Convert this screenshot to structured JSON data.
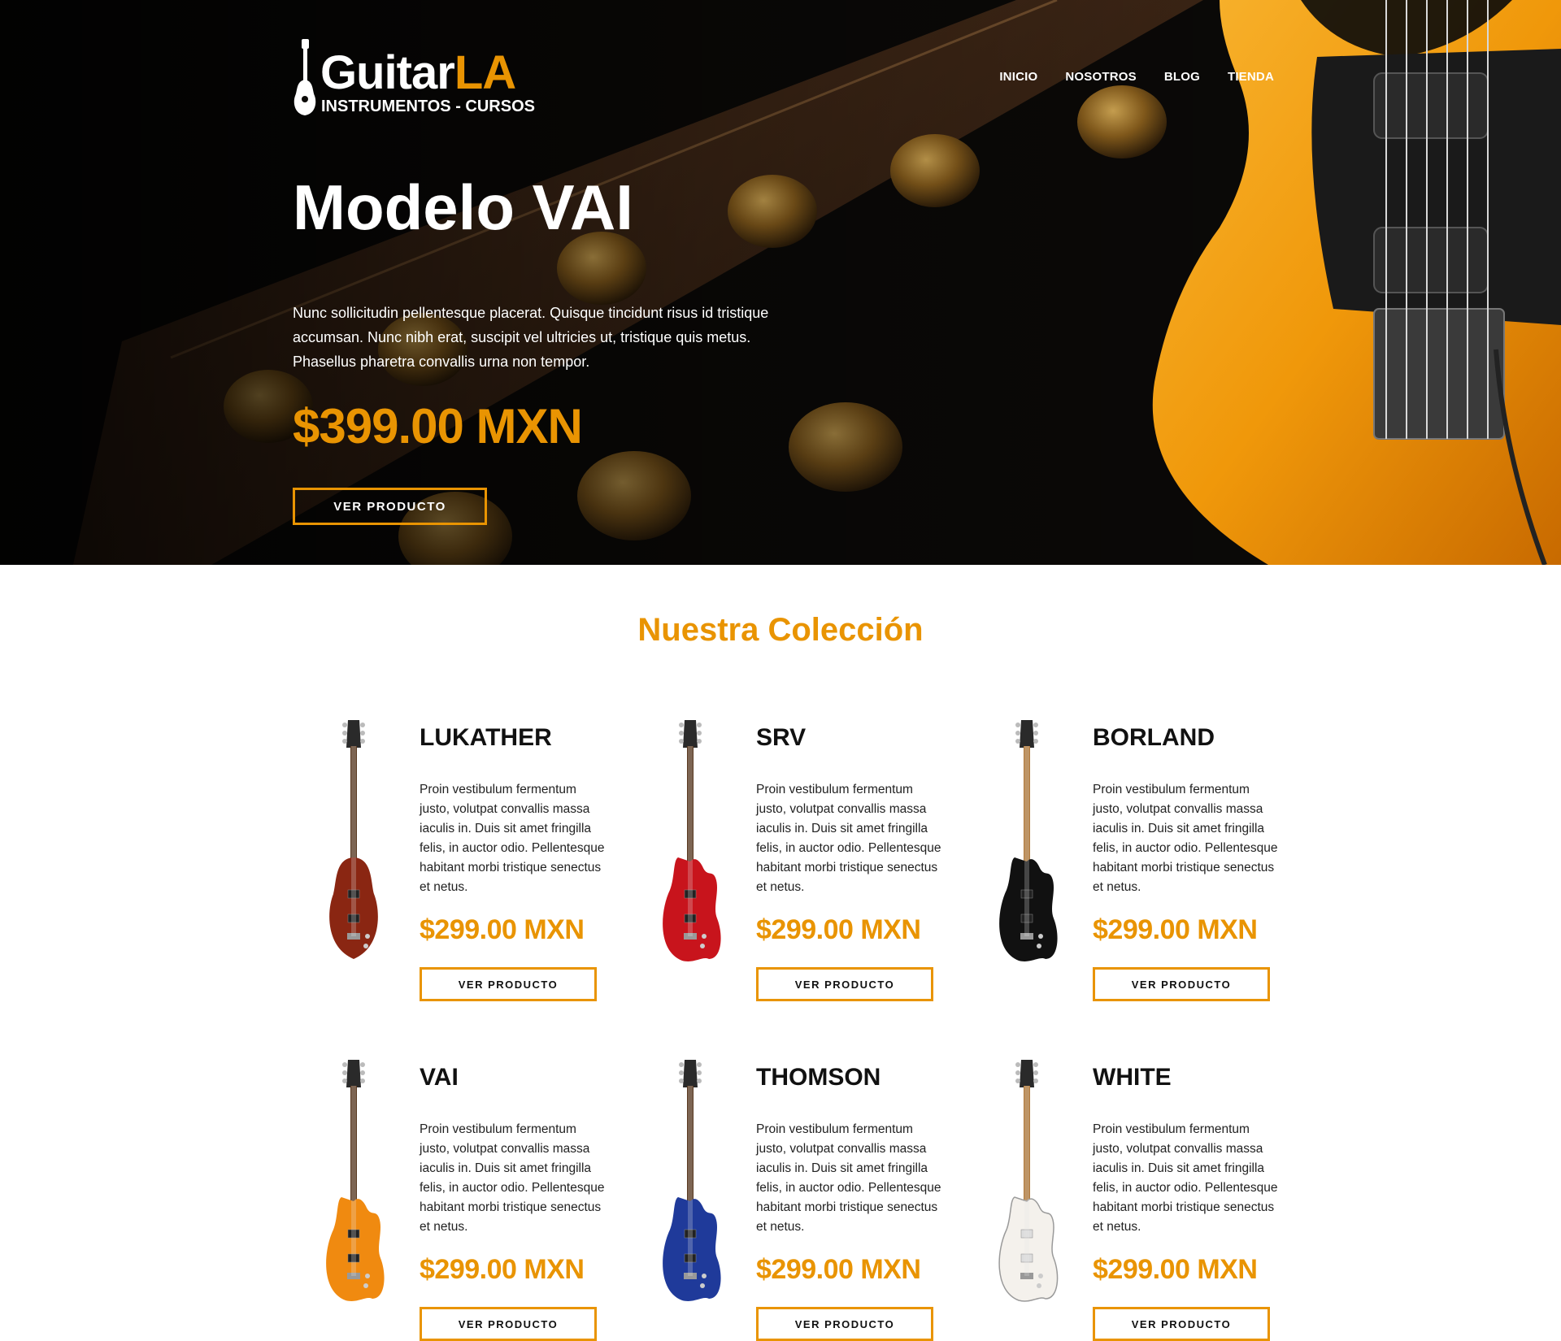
{
  "brand": {
    "name_main": "Guitar",
    "name_accent": "LA",
    "tagline": "INSTRUMENTOS - CURSOS"
  },
  "nav": {
    "items": [
      "INICIO",
      "NOSOTROS",
      "BLOG",
      "TIENDA"
    ]
  },
  "hero": {
    "title": "Modelo VAI",
    "description": "Nunc sollicitudin pellentesque placerat. Quisque tincidunt risus id tristique accumsan. Nunc nibh erat, suscipit vel ultricies ut, tristique quis metus. Phasellus pharetra convallis urna non tempor.",
    "price": "$399.00 MXN",
    "button_label": "VER PRODUCTO"
  },
  "collection": {
    "title": "Nuestra Colección",
    "products": [
      {
        "name": "LUKATHER",
        "description": "Proin vestibulum fermentum justo, volutpat convallis massa iaculis in. Duis sit amet fringilla felis, in auctor odio. Pellentesque habitant morbi tristique senectus et netus.",
        "price": "$299.00 MXN",
        "button_label": "VER PRODUCTO",
        "body_color": "#8a2612"
      },
      {
        "name": "SRV",
        "description": "Proin vestibulum fermentum justo, volutpat convallis massa iaculis in. Duis sit amet fringilla felis, in auctor odio. Pellentesque habitant morbi tristique senectus et netus.",
        "price": "$299.00 MXN",
        "button_label": "VER PRODUCTO",
        "body_color": "#c8141c"
      },
      {
        "name": "BORLAND",
        "description": "Proin vestibulum fermentum justo, volutpat convallis massa iaculis in. Duis sit amet fringilla felis, in auctor odio. Pellentesque habitant morbi tristique senectus et netus.",
        "price": "$299.00 MXN",
        "button_label": "VER PRODUCTO",
        "body_color": "#111111"
      },
      {
        "name": "VAI",
        "description": "Proin vestibulum fermentum justo, volutpat convallis massa iaculis in. Duis sit amet fringilla felis, in auctor odio. Pellentesque habitant morbi tristique senectus et netus.",
        "price": "$299.00 MXN",
        "button_label": "VER PRODUCTO",
        "body_color": "#f08a10"
      },
      {
        "name": "THOMSON",
        "description": "Proin vestibulum fermentum justo, volutpat convallis massa iaculis in. Duis sit amet fringilla felis, in auctor odio. Pellentesque habitant morbi tristique senectus et netus.",
        "price": "$299.00 MXN",
        "button_label": "VER PRODUCTO",
        "body_color": "#1f3a9a"
      },
      {
        "name": "WHITE",
        "description": "Proin vestibulum fermentum justo, volutpat convallis massa iaculis in. Duis sit amet fringilla felis, in auctor odio. Pellentesque habitant morbi tristique senectus et netus.",
        "price": "$299.00 MXN",
        "button_label": "VER PRODUCTO",
        "body_color": "#f4f1ec"
      }
    ]
  },
  "colors": {
    "accent": "#e99402",
    "hero_dark": "#0a0a0a",
    "text": "#111111"
  }
}
